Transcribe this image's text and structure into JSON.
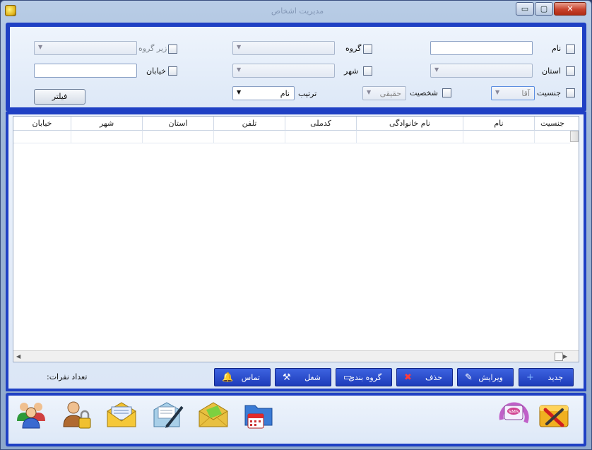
{
  "window": {
    "title": "مدیریت اشخاص",
    "min_label": "▭",
    "max_label": "▢",
    "close_label": "✕"
  },
  "filters": {
    "name_label": "نام",
    "group_label": "گروه",
    "subgroup_label": "زیر گروه",
    "province_label": "استان",
    "city_label": "شهر",
    "street_label": "خیابان",
    "gender_label": "جنسیت",
    "gender_value": "آقا",
    "person_type_label": "شخصیت",
    "person_type_value": "حقیقی",
    "sort_label": "ترتیب",
    "sort_value": "نام",
    "filter_button": "فیلتر"
  },
  "grid": {
    "columns": [
      "جنسیت",
      "نام",
      "نام خانوادگی",
      "کدملی",
      "تلفن",
      "استان",
      "شهر",
      "خیابان"
    ]
  },
  "actions": {
    "new": "جدید",
    "edit": "ویرایش",
    "delete": "حذف",
    "grouping": "گروه بندی",
    "job": "شغل",
    "contact": "تماس",
    "count_label": "تعداد نفرات:"
  },
  "colors": {
    "panel_border": "#1f40c4",
    "button_blue": "#2a4cd0"
  }
}
